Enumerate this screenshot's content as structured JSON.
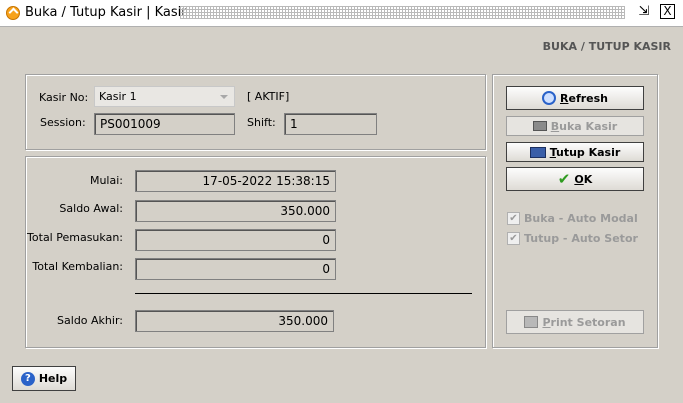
{
  "window": {
    "title": "Buka / Tutup Kasir | Kasir",
    "minmax_glyph": "⇲",
    "close_glyph": "X"
  },
  "header": {
    "label": "BUKA / TUTUP KASIR"
  },
  "top_panel": {
    "kasir_label": "Kasir No:",
    "kasir_value": "Kasir 1",
    "status": "[ AKTIF]",
    "session_label": "Session:",
    "session_value": "PS001009",
    "shift_label": "Shift:",
    "shift_value": "1"
  },
  "details": {
    "mulai_label": "Mulai:",
    "mulai_value": "17-05-2022 15:38:15",
    "saldo_awal_label": "Saldo Awal:",
    "saldo_awal_value": "350.000",
    "total_pemasukan_label": "Total Pemasukan:",
    "total_pemasukan_value": "0",
    "total_kembalian_label": "Total Kembalian:",
    "total_kembalian_value": "0",
    "saldo_akhir_label": "Saldo Akhir:",
    "saldo_akhir_value": "350.000"
  },
  "actions": {
    "refresh_u": "R",
    "refresh_rest": "efresh",
    "buka_u": "B",
    "buka_rest": "uka Kasir",
    "tutup_u": "T",
    "tutup_rest": "utup Kasir",
    "ok_u": "O",
    "ok_rest": "K",
    "print_u": "P",
    "print_rest": "rint Setoran"
  },
  "options": {
    "buka_auto_modal": "Buka - Auto Modal",
    "tutup_auto_setor": "Tutup - Auto Setor",
    "check_glyph": "✔"
  },
  "help": {
    "label": "Help",
    "glyph": "?"
  }
}
